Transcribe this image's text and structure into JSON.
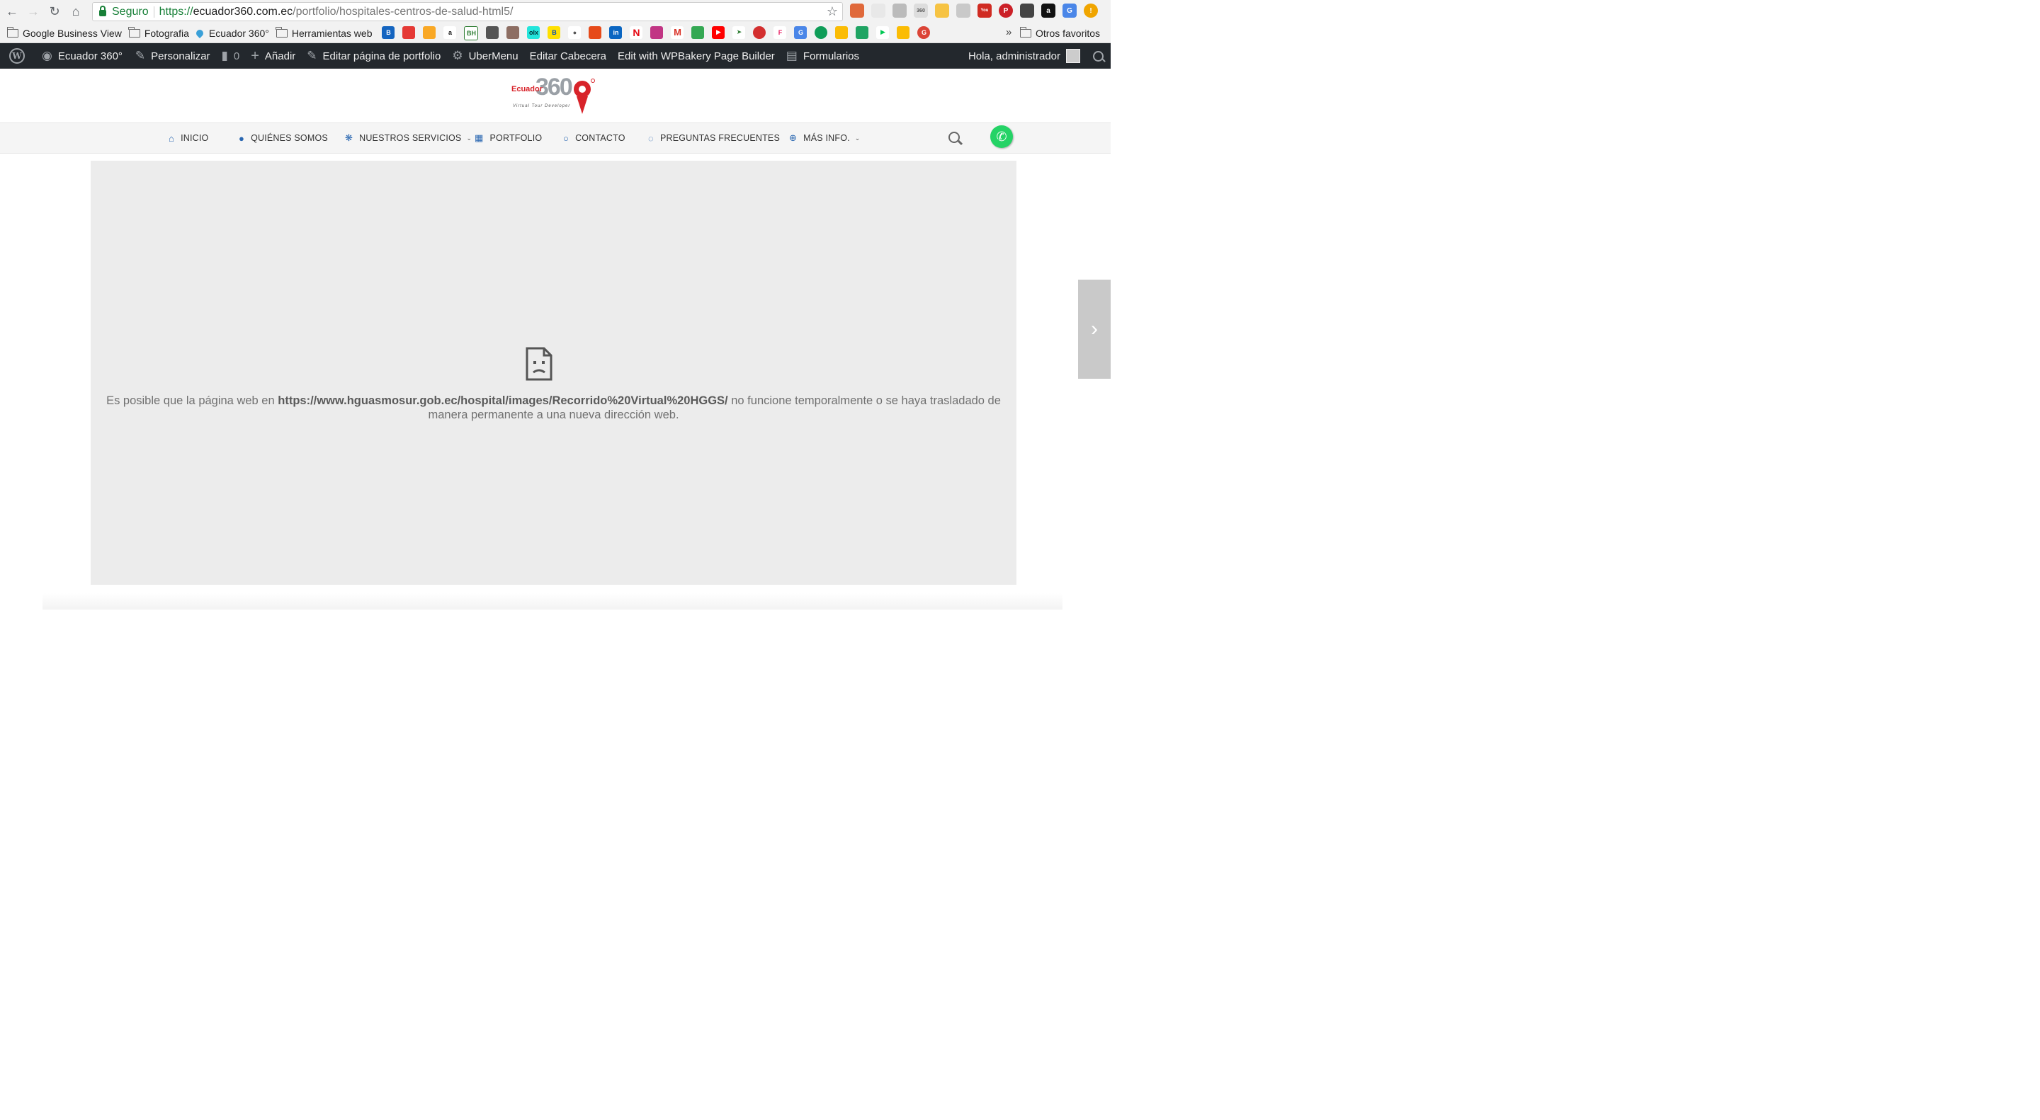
{
  "browser": {
    "secure_label": "Seguro",
    "url_scheme": "https://",
    "url_host": "ecuador360.com.ec",
    "url_path": "/portfolio/hospitales-centros-de-salud-html5/",
    "bookmarks": [
      "Google Business View",
      "Fotografia",
      "Ecuador 360°",
      "Herramientas web"
    ],
    "other_bookmarks": "Otros favoritos"
  },
  "adminbar": {
    "site": "Ecuador 360°",
    "customize": "Personalizar",
    "comments": "0",
    "add": "Añadir",
    "edit_portfolio": "Editar página de portfolio",
    "ubermenu": "UberMenu",
    "edit_header": "Editar Cabecera",
    "wpbakery": "Edit with WPBakery Page Builder",
    "forms": "Formularios",
    "greeting": "Hola, administrador"
  },
  "logo": {
    "word": "Ecuador",
    "number": "360",
    "tagline": "Virtual Tour Developer"
  },
  "nav": {
    "items": [
      {
        "label": "INICIO"
      },
      {
        "label": "QUIÉNES SOMOS"
      },
      {
        "label": "NUESTROS SERVICIOS"
      },
      {
        "label": "PORTFOLIO"
      },
      {
        "label": "CONTACTO"
      },
      {
        "label": "PREGUNTAS FRECUENTES"
      },
      {
        "label": "MÁS INFO."
      }
    ]
  },
  "error": {
    "prefix": "Es posible que la página web en ",
    "url": "https://www.hguasmosur.gob.ec/hospital/images/Recorrido%20Virtual%20HGGS/",
    "suffix": " no funcione temporalmente o se haya trasladado de manera permanente a una nueva dirección web."
  },
  "colors": {
    "adminbar": "#23282d",
    "nav_icon": "#2a67b1",
    "brand_red": "#d8232a",
    "whatsapp": "#25d366"
  }
}
